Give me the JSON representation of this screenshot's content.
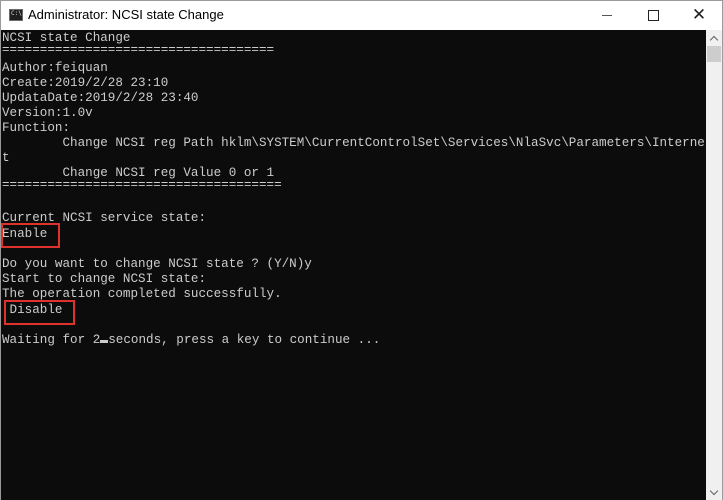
{
  "window": {
    "title": "Administrator:  NCSI state Change",
    "icon": "console-icon",
    "controls": {
      "minimize": "minimize-icon",
      "maximize": "maximize-icon",
      "close": "close-icon",
      "close_glyph": "✕"
    }
  },
  "console": {
    "lines": [
      "NCSI state Change",
      "====================================",
      "Author:feiquan",
      "Create:2019/2/28 23:10",
      "UpdataDate:2019/2/28 23:40",
      "Version:1.0v",
      "Function:",
      "        Change NCSI reg Path hklm\\SYSTEM\\CurrentControlSet\\Services\\NlaSvc\\Parameters\\Interne",
      "t",
      "        Change NCSI reg Value 0 or 1",
      "=====================================",
      "",
      "Current NCSI service state:",
      "Enable",
      "",
      "Do you want to change NCSI state ? (Y/N)y",
      "Start to change NCSI state:",
      "The operation completed successfully.",
      " Disable",
      "",
      "Waiting for 2",
      "seconds, press a key to continue ..."
    ],
    "highlight_color": "#e0322d",
    "text_color": "#cccccc",
    "background": "#0c0c0c"
  },
  "scrollbar": {
    "up": "chevron-up-icon",
    "down": "chevron-down-icon"
  }
}
